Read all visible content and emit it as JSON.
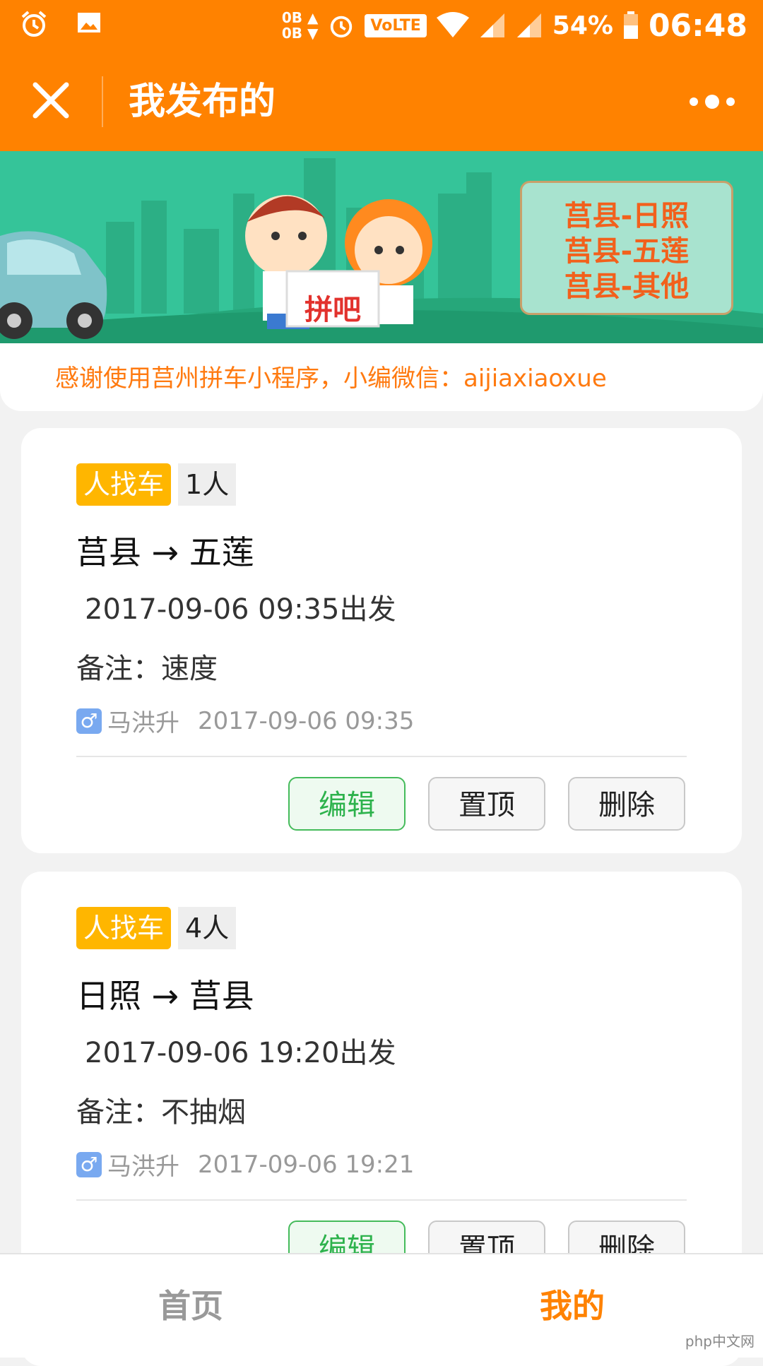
{
  "status_bar": {
    "time": "06:48",
    "battery": "54%",
    "net_up": "0B",
    "net_down": "0B",
    "volte": "VoLTE"
  },
  "header": {
    "title": "我发布的"
  },
  "banner": {
    "routes": [
      "莒县-日照",
      "莒县-五莲",
      "莒县-其他"
    ],
    "sign_text": "拼吧"
  },
  "notice": "感谢使用莒州拼车小程序，小编微信：aijiaxiaoxue",
  "posts": [
    {
      "type": "人找车",
      "count": "1人",
      "from": "莒县",
      "arrow": "→",
      "to": "五莲",
      "depart": "2017-09-06 09:35出发",
      "remark": "备注：速度",
      "gender": "♂",
      "user": "马洪升",
      "posted": "2017-09-06 09:35"
    },
    {
      "type": "人找车",
      "count": "4人",
      "from": "日照",
      "arrow": "→",
      "to": "莒县",
      "depart": "2017-09-06 19:20出发",
      "remark": "备注：不抽烟",
      "gender": "♂",
      "user": "马洪升",
      "posted": "2017-09-06 19:21"
    }
  ],
  "actions": {
    "edit": "编辑",
    "top": "置顶",
    "delete": "删除"
  },
  "tabs": {
    "home": "首页",
    "mine": "我的"
  },
  "watermark": "php中文网",
  "colors": {
    "brand": "#ff8200",
    "tag": "#ffb600",
    "edit": "#2db24c"
  }
}
